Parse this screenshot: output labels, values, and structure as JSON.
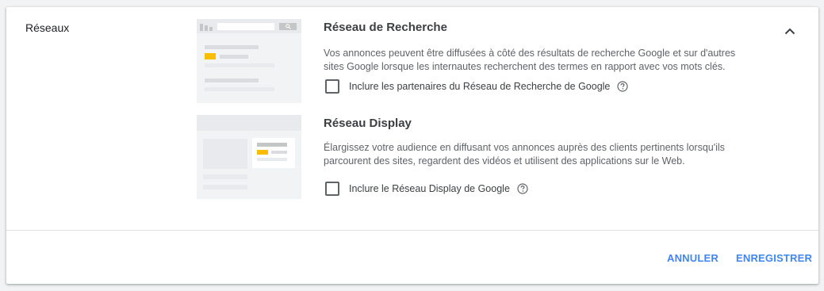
{
  "section": {
    "label": "Réseaux"
  },
  "search_network": {
    "title": "Réseau de Recherche",
    "description_line1": "Vos annonces peuvent être diffusées à côté des résultats de recherche Google et sur d'autres",
    "description_line2": "sites Google lorsque les internautes recherchent des termes en rapport avec vos mots clés.",
    "checkbox_label": "Inclure les partenaires du Réseau de Recherche de Google",
    "checked": false
  },
  "display_network": {
    "title": "Réseau Display",
    "description_line1": "Élargissez votre audience en diffusant vos annonces auprès des clients pertinents lorsqu'ils",
    "description_line2": "parcourent des sites, regardent des vidéos et utilisent des applications sur le Web.",
    "checkbox_label": "Inclure le Réseau Display de Google",
    "checked": false
  },
  "actions": {
    "cancel": "ANNULER",
    "save": "ENREGISTRER"
  },
  "icons": {
    "collapse": "chevron-up-icon",
    "help": "help-circle-icon",
    "search": "search-icon"
  },
  "colors": {
    "accent": "#4285f4",
    "ad_highlight": "#fbbc04",
    "illustration_bg": "#f1f3f4",
    "illustration_bar": "#dadce0"
  }
}
